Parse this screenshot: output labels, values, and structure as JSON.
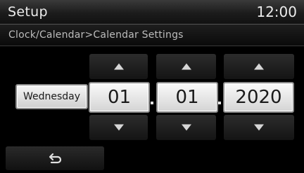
{
  "header": {
    "title": "Setup",
    "clock": "12:00"
  },
  "breadcrumb": "Clock/Calendar>Calendar Settings",
  "calendar": {
    "day_of_week": "Wednesday",
    "day": "01",
    "month": "01",
    "year": "2020",
    "separator": "."
  },
  "icons": {
    "up": "triangle-up-icon",
    "down": "triangle-down-icon",
    "back": "back-return-icon"
  }
}
